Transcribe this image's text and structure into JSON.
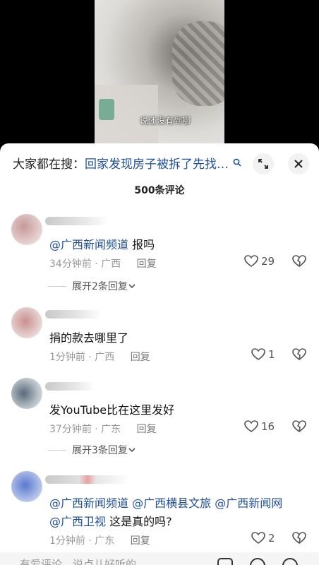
{
  "video": {
    "caption": "说还没有到哪"
  },
  "header": {
    "search_prefix": "大家都在搜：",
    "search_query": "回家发现房子被拆了先找…"
  },
  "comment_count": "500条评论",
  "comments": [
    {
      "mentions": [
        "@广西新闻频道"
      ],
      "text": "报吗",
      "meta": "34分钟前 · 广西",
      "reply_label": "回复",
      "likes": "29",
      "expand": "展开2条回复"
    },
    {
      "mentions": [],
      "text": "捐的款去哪里了",
      "meta": "1分钟前 · 广西",
      "reply_label": "回复",
      "likes": "1"
    },
    {
      "mentions": [],
      "text": "发YouTube比在这里发好",
      "meta": "37分钟前 · 广东",
      "reply_label": "回复",
      "likes": "16",
      "expand": "展开3条回复"
    },
    {
      "mentions": [
        "@广西新闻频道",
        "@广西横县文旅",
        "@广西新闻网",
        "@广西卫视"
      ],
      "text": "这是真的吗?",
      "meta": "1分钟前 · 广东",
      "reply_label": "回复",
      "likes": "2"
    }
  ],
  "input": {
    "placeholder": "有爱评论，说点儿好听的"
  },
  "colors": {
    "link": "#1f4f9c",
    "meta": "#999999"
  }
}
